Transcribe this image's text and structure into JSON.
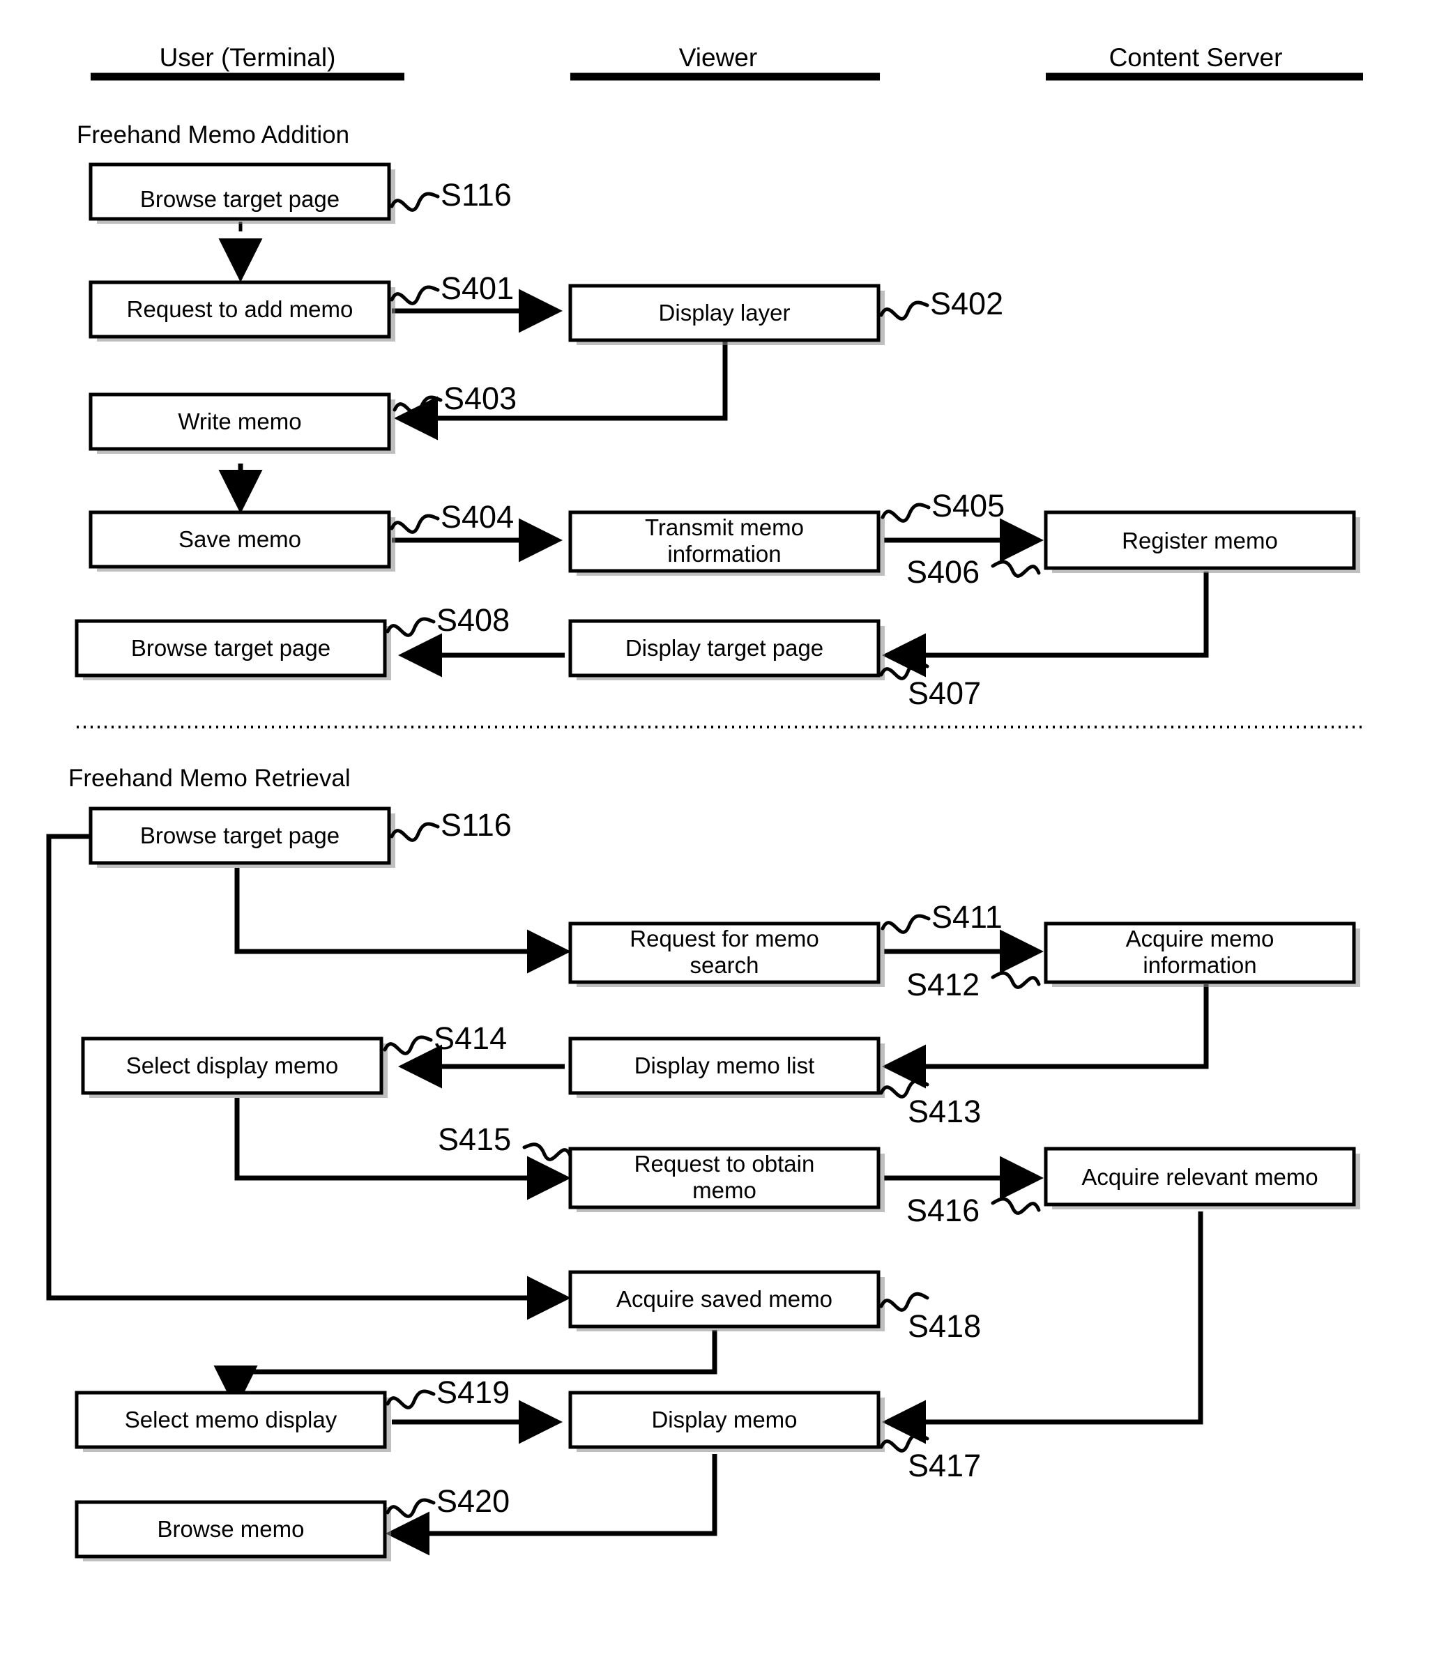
{
  "lanes": [
    {
      "id": "user",
      "title": "User (Terminal)"
    },
    {
      "id": "viewer",
      "title": "Viewer"
    },
    {
      "id": "server",
      "title": "Content Server"
    }
  ],
  "sections": [
    {
      "id": "addition",
      "title": "Freehand Memo Addition"
    },
    {
      "id": "retrieval",
      "title": "Freehand Memo Retrieval"
    }
  ],
  "nodes": {
    "a_browse_target": "Browse target page",
    "a_request_add": "Request to add memo",
    "a_display_layer": "Display layer",
    "a_write_memo": "Write memo",
    "a_save_memo": "Save memo",
    "a_transmit_memo_line1": "Transmit memo",
    "a_transmit_memo_line2": "information",
    "a_register_memo": "Register memo",
    "a_browse_target2": "Browse target page",
    "a_display_target": "Display target page",
    "r_browse_target": "Browse target page",
    "r_request_search_line1": "Request for memo",
    "r_request_search_line2": "search",
    "r_acquire_info_line1": "Acquire memo",
    "r_acquire_info_line2": "information",
    "r_select_display_memo": "Select display memo",
    "r_display_memo_list": "Display memo list",
    "r_request_obtain_line1": "Request to obtain",
    "r_request_obtain_line2": "memo",
    "r_acquire_relevant": "Acquire relevant memo",
    "r_acquire_saved": "Acquire saved memo",
    "r_select_memo_display": "Select memo display",
    "r_display_memo": "Display memo",
    "r_browse_memo": "Browse memo"
  },
  "steps": {
    "s116a": "S116",
    "s401": "S401",
    "s402": "S402",
    "s403": "S403",
    "s404": "S404",
    "s405": "S405",
    "s406": "S406",
    "s407": "S407",
    "s408": "S408",
    "s116b": "S116",
    "s411": "S411",
    "s412": "S412",
    "s413": "S413",
    "s414": "S414",
    "s415": "S415",
    "s416": "S416",
    "s417": "S417",
    "s418": "S418",
    "s419": "S419",
    "s420": "S420"
  },
  "colors": {
    "ink": "#000000",
    "paper": "#ffffff",
    "shadow": "#8a8a8a"
  }
}
